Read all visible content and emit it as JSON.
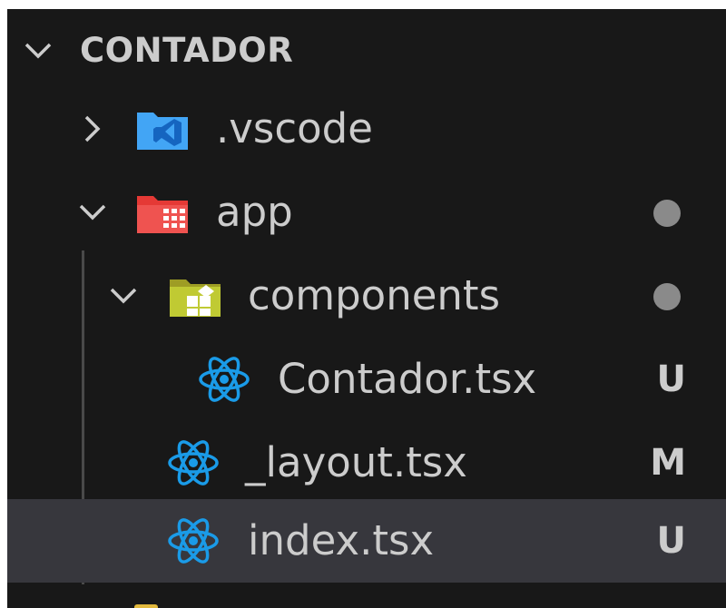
{
  "explorer": {
    "section_title": "CONTADOR",
    "items": [
      {
        "label": ".vscode",
        "icon": "vscode-folder-icon",
        "expanded": false
      },
      {
        "label": "app",
        "icon": "app-folder-icon",
        "expanded": true,
        "status": "modified-dot"
      },
      {
        "label": "components",
        "icon": "components-folder-icon",
        "expanded": true,
        "status": "modified-dot"
      },
      {
        "label": "Contador.tsx",
        "icon": "react-file-icon",
        "badge": "U"
      },
      {
        "label": "_layout.tsx",
        "icon": "react-file-icon",
        "badge": "M"
      },
      {
        "label": "index.tsx",
        "icon": "react-file-icon",
        "badge": "U",
        "selected": true
      }
    ]
  },
  "colors": {
    "background": "#181818",
    "selected_row": "#37373d",
    "text": "#cccccc",
    "react_icon": "#1a9be8",
    "vscode_folder": "#42a5f5",
    "app_folder": "#e53935",
    "components_folder": "#c0ca33"
  }
}
